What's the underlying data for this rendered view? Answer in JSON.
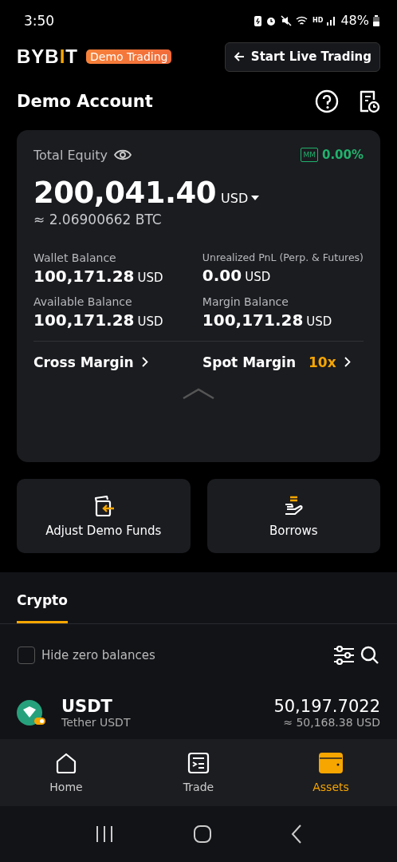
{
  "status_bar": {
    "time": "3:50",
    "hd": "HD",
    "battery": "48%"
  },
  "header": {
    "logo": "BYBIT",
    "badge": "Demo Trading",
    "live_button": "Start Live Trading"
  },
  "account": {
    "title": "Demo Account"
  },
  "card": {
    "equity_label": "Total Equity",
    "mm_badge": "MM",
    "mm_value": "0.00%",
    "equity": "200,041.40",
    "currency": "USD",
    "btc": "≈ 2.06900662 BTC",
    "stats": [
      {
        "label": "Wallet Balance",
        "value": "100,171.28",
        "unit": "USD"
      },
      {
        "label": "Unrealized PnL (Perp. & Futures)",
        "value": "0.00",
        "unit": "USD"
      },
      {
        "label": "Available Balance",
        "value": "100,171.28",
        "unit": "USD"
      },
      {
        "label": "Margin Balance",
        "value": "100,171.28",
        "unit": "USD"
      }
    ],
    "links": [
      {
        "label": "Cross Margin"
      },
      {
        "label": "Spot Margin",
        "tag": "10x"
      }
    ]
  },
  "actions": [
    {
      "kind": "funds",
      "label": "Adjust Demo Funds"
    },
    {
      "kind": "borrow",
      "label": "Borrows"
    }
  ],
  "tabs": [
    {
      "label": "Crypto",
      "selected": true
    }
  ],
  "hide_zero": {
    "label": "Hide zero balances",
    "checked": false
  },
  "assets": [
    {
      "symbol": "USDT",
      "name": "Tether USDT",
      "amount": "50,197.7022",
      "usd": "≈ 50,168.38 USD"
    }
  ],
  "nav": [
    {
      "kind": "home",
      "label": "Home",
      "selected": false
    },
    {
      "kind": "trade",
      "label": "Trade",
      "selected": false
    },
    {
      "kind": "assets",
      "label": "Assets",
      "selected": true
    }
  ]
}
